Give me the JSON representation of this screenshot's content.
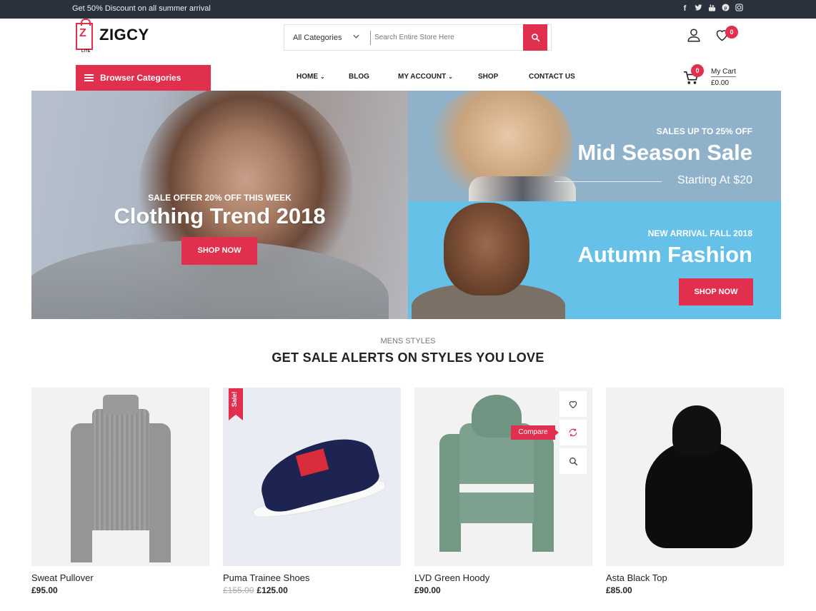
{
  "topbar": {
    "promo": "Get 50% Discount on all summer arrival",
    "social": [
      {
        "icon": "facebook-icon",
        "glyph": "f"
      },
      {
        "icon": "twitter-icon",
        "glyph": "t"
      },
      {
        "icon": "youtube-icon",
        "glyph": "▶"
      },
      {
        "icon": "pinterest-icon",
        "glyph": "p"
      },
      {
        "icon": "instagram-icon",
        "glyph": "◎"
      }
    ]
  },
  "header": {
    "logo": {
      "name": "ZIGCY",
      "sub": "LITE",
      "mark": "Z"
    },
    "search": {
      "category": "All Categories",
      "placeholder": "Search Entire Store Here",
      "value": ""
    },
    "wishlist_count": "0",
    "cart": {
      "label": "My Cart",
      "amount": "£0.00",
      "count": "0"
    }
  },
  "nav": {
    "browse_label": "Browser Categories",
    "items": [
      {
        "label": "HOME",
        "dropdown": "⌄"
      },
      {
        "label": "BLOG",
        "dropdown": ""
      },
      {
        "label": "MY ACCOUNT",
        "dropdown": "⌄"
      },
      {
        "label": "SHOP",
        "dropdown": ""
      },
      {
        "label": "CONTACT US",
        "dropdown": ""
      }
    ]
  },
  "banners": {
    "main": {
      "subtitle": "SALE OFFER 20% OFF THIS WEEK",
      "title": "Clothing Trend 2018",
      "button": "SHOP NOW"
    },
    "top": {
      "subtitle": "SALES UP TO 25% OFF",
      "title": "Mid Season Sale",
      "starting": "Starting At $20"
    },
    "bottom": {
      "subtitle": "NEW ARRIVAL FALL 2018",
      "title": "Autumn Fashion",
      "button": "SHOP NOW"
    }
  },
  "section": {
    "subtitle": "MENS STYLES",
    "title": "GET SALE ALERTS ON STYLES YOU LOVE"
  },
  "products": [
    {
      "name": "Sweat Pullover",
      "price": "£95.00",
      "old_price": ""
    },
    {
      "name": "Puma Trainee Shoes",
      "price": "£125.00",
      "old_price": "£155.00",
      "badge": "Sale!"
    },
    {
      "name": "LVD Green Hoody",
      "price": "£90.00",
      "old_price": "",
      "tooltip": "Compare"
    },
    {
      "name": "Asta Black Top",
      "price": "£85.00",
      "old_price": ""
    }
  ],
  "colors": {
    "accent": "#e0304e",
    "topbar": "#2a313d"
  }
}
